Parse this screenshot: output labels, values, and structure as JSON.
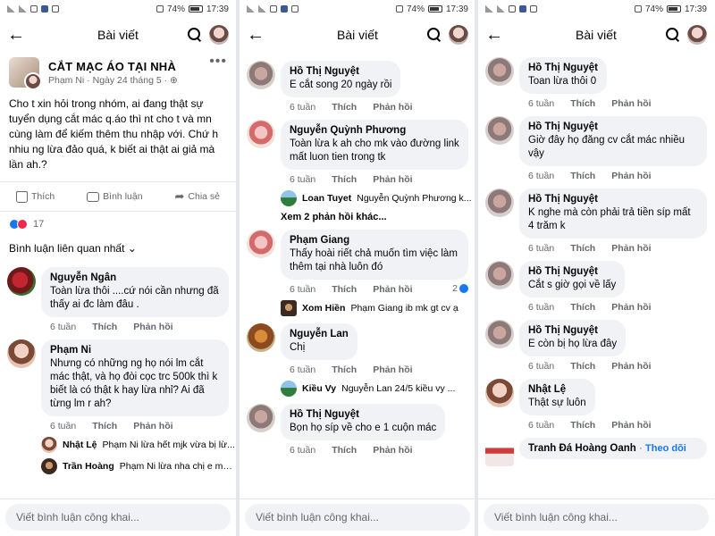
{
  "status": {
    "battery": "74%",
    "time": "17:39"
  },
  "header": {
    "title": "Bài viết"
  },
  "post": {
    "page_name": "CẮT MẠC ÁO TẠI NHÀ",
    "author": "Phạm Ni",
    "date": "Ngày 24 tháng 5",
    "body": "Cho t xin hỏi trong nhóm, ai đang thật sự tuyển dụng cắt mác q.áo thì nt cho t và mn cùng làm để kiếm thêm thu nhập với. Chứ h nhiu ng lừa đảo quá, k biết ai thật ai giả mà lần ah.?",
    "like_label": "Thích",
    "comment_label": "Bình luận",
    "share_label": "Chia sẻ",
    "reaction_count": "17",
    "sort_label": "Bình luận liên quan nhất"
  },
  "labels": {
    "time": "6 tuần",
    "like": "Thích",
    "reply": "Phản hồi",
    "composer_placeholder": "Viết bình luận công khai...",
    "follow": "Theo dõi"
  },
  "panel1": {
    "comments": [
      {
        "name": "Nguyễn Ngân",
        "text": "Toàn lừa thôi ....cứ nói cần nhưng đã thấy ai đc làm đâu ."
      },
      {
        "name": "Phạm Ni",
        "text": "Nhưng có những ng họ nói lm cắt mác thật, và họ đòi cọc trc 500k thì k biết là có thật k hay lừa nhỉ? Ai đã từng lm r ah?"
      }
    ],
    "replies": [
      {
        "name": "Nhật Lệ",
        "text": "Phạm Ni lừa hết mjk vừa bị lừ..."
      },
      {
        "name": "Trần Hoàng",
        "text": "Phạm Ni lừa nha chị e mớ..."
      }
    ]
  },
  "panel2": {
    "comments": [
      {
        "name": "Hồ Thị Nguyệt",
        "text": "E cắt song 20 ngày rồi"
      },
      {
        "name": "Nguyễn Quỳnh Phương",
        "text": "Toàn lừa k ah cho mk vào đường link mất luon tien trong tk"
      },
      {
        "name": "Phạm Giang",
        "text": "Thấy hoài riết chả muốn tìm việc làm thêm tại nhà luôn đó",
        "reactions": "2"
      },
      {
        "name": "Nguyễn Lan",
        "text": "Chị"
      },
      {
        "name": "Hồ Thị Nguyệt",
        "text": "Bọn họ síp về cho e 1 cuộn mác"
      }
    ],
    "replies": [
      {
        "name": "Loan Tuyet",
        "text": "Nguyễn Quỳnh Phương k..."
      },
      {
        "name": "Xom Hiền",
        "text": "Phạm Giang ib mk gt cv ạ"
      },
      {
        "name": "Kiều Vy",
        "text": "Nguyễn Lan 24/5 kiều vy ..."
      }
    ],
    "more_replies": "Xem 2 phản hồi khác..."
  },
  "panel3": {
    "comments": [
      {
        "name": "Hồ Thị Nguyệt",
        "text": "Toan lừa thôi 0"
      },
      {
        "name": "Hồ Thị Nguyệt",
        "text": "Giờ đây họ đăng cv cắt mác nhiều vậy"
      },
      {
        "name": "Hồ Thị Nguyệt",
        "text": "K nghe mà còn phải trả tiền síp mất 4 trăm k"
      },
      {
        "name": "Hồ Thị Nguyệt",
        "text": "Cắt s giờ gọi về lấy"
      },
      {
        "name": "Hồ Thị Nguyệt",
        "text": "E còn bị họ lừa đây"
      },
      {
        "name": "Nhật Lệ",
        "text": "Thật sự luôn"
      },
      {
        "name": "Tranh Đá Hoàng Oanh",
        "text": ""
      }
    ]
  }
}
